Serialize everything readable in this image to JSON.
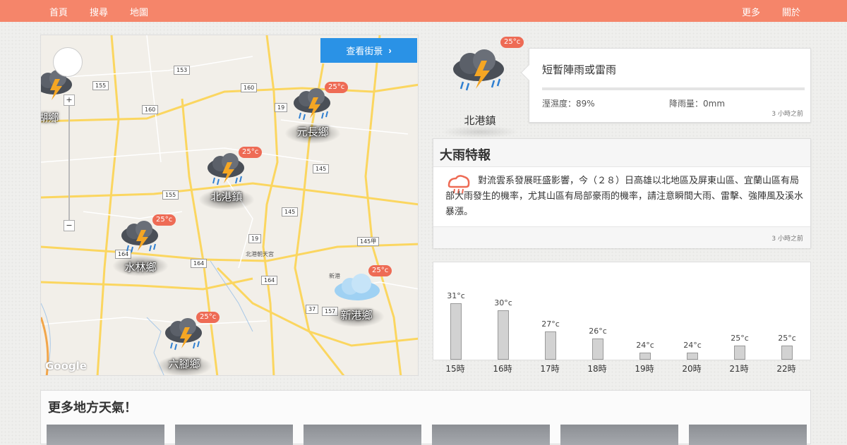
{
  "nav": {
    "home": "首頁",
    "search": "搜尋",
    "map": "地圖",
    "more": "更多",
    "about": "關於"
  },
  "map": {
    "street_view_button": "查看街景",
    "google_logo": "Google",
    "roads": [
      "153",
      "155",
      "160",
      "160",
      "19",
      "145",
      "155",
      "145",
      "19",
      "145甲",
      "164",
      "164",
      "164",
      "37",
      "157",
      "164"
    ],
    "places": [
      "北港朝天宮",
      "新港",
      "湖鄉"
    ],
    "towns": [
      {
        "name": "北港鎮",
        "temp": "25°c"
      },
      {
        "name": "元長鄉",
        "temp": "25°c"
      },
      {
        "name": "水林鄉",
        "temp": "25°c"
      },
      {
        "name": "新港鄉",
        "temp": "25°c"
      },
      {
        "name": "六腳鄉",
        "temp": "25°c"
      }
    ]
  },
  "current": {
    "town": "北港鎮",
    "temp": "25°c",
    "description": "短暫陣雨或雷雨",
    "humidity": "溼濕度：89%",
    "rainfall": "降雨量：0mm",
    "updated": "3 小時之前"
  },
  "warning": {
    "title": "大雨特報",
    "body": "對流雲系發展旺盛影響，今（２８）日高雄以北地區及屏東山區、宜蘭山區有局部大雨發生的機率，尤其山區有局部豪雨的機率，請注意瞬間大雨、雷擊、強陣風及溪水暴漲。",
    "updated": "3 小時之前"
  },
  "hourly": {
    "hours": [
      "15時",
      "16時",
      "17時",
      "18時",
      "19時",
      "20時",
      "21時",
      "22時"
    ],
    "temps": [
      "31°c",
      "30°c",
      "27°c",
      "26°c",
      "24°c",
      "24°c",
      "25°c",
      "25°c"
    ],
    "values": [
      31,
      30,
      27,
      26,
      24,
      24,
      25,
      25
    ]
  },
  "more_places": {
    "title": "更多地方天氣！"
  },
  "colors": {
    "accent": "#f5856a",
    "temp_badge": "#ee6b55",
    "button": "#2a92e6"
  }
}
